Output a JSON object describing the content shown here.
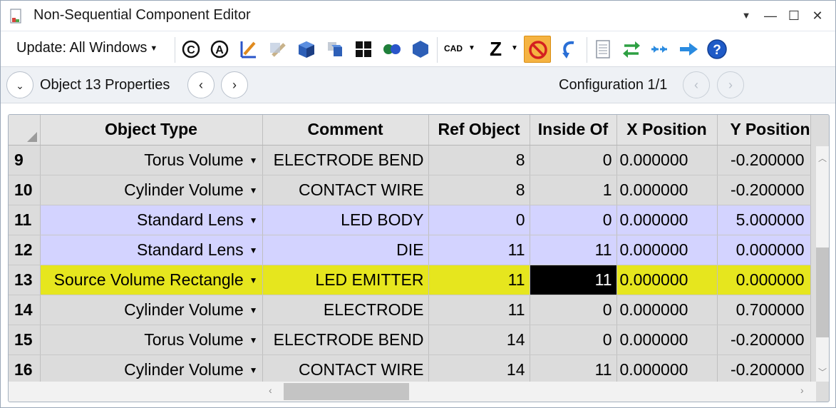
{
  "window": {
    "title": "Non-Sequential Component Editor"
  },
  "title_buttons": {
    "dropdown": "▼",
    "minimize": "—",
    "maximize": "☐",
    "close": "✕"
  },
  "toolbar": {
    "update_label": "Update: All Windows",
    "icons": [
      "reload-c-icon",
      "reload-a-icon",
      "pencil-ruler-icon",
      "pencil-disabled-icon",
      "cube-icon",
      "cube-stack-icon",
      "grid-squares-icon",
      "dots-icon",
      "hexagon-icon",
      "cad-icon",
      "z-icon",
      "no-entry-icon",
      "undo-arrow-icon",
      "report-icon",
      "swap-arrows-icon",
      "dash-arrows-icon",
      "right-arrow-icon",
      "help-icon"
    ],
    "cad_label": "CAD",
    "z_label": "Z",
    "accent_active": "#f5b342"
  },
  "objectbar": {
    "object_label": "Object  13 Properties",
    "config_label": "Configuration 1/1"
  },
  "grid": {
    "headers": [
      "Object Type",
      "Comment",
      "Ref Object",
      "Inside Of",
      "X Position",
      "Y Position"
    ],
    "rows": [
      {
        "num": "9",
        "type": "Torus Volume",
        "comment": "ELECTRODE BEND",
        "ref": "8",
        "inside": "0",
        "x": "0.000000",
        "y": "-0.200000",
        "style": "gray"
      },
      {
        "num": "10",
        "type": "Cylinder Volume",
        "comment": "CONTACT WIRE",
        "ref": "8",
        "inside": "1",
        "x": "0.000000",
        "y": "-0.200000",
        "style": "gray"
      },
      {
        "num": "11",
        "type": "Standard Lens",
        "comment": "LED BODY",
        "ref": "0",
        "inside": "0",
        "x": "0.000000",
        "y": "5.000000",
        "style": "lav"
      },
      {
        "num": "12",
        "type": "Standard Lens",
        "comment": "DIE",
        "ref": "11",
        "inside": "11",
        "x": "0.000000",
        "y": "0.000000",
        "style": "lav"
      },
      {
        "num": "13",
        "type": "Source Volume Rectangle",
        "comment": "LED EMITTER",
        "ref": "11",
        "inside": "11",
        "x": "0.000000",
        "y": "0.000000",
        "style": "yel"
      },
      {
        "num": "14",
        "type": "Cylinder Volume",
        "comment": "ELECTRODE",
        "ref": "11",
        "inside": "0",
        "x": "0.000000",
        "y": "0.700000",
        "style": "gray"
      },
      {
        "num": "15",
        "type": "Torus Volume",
        "comment": "ELECTRODE BEND",
        "ref": "14",
        "inside": "0",
        "x": "0.000000",
        "y": "-0.200000",
        "style": "gray"
      },
      {
        "num": "16",
        "type": "Cylinder Volume",
        "comment": "CONTACT WIRE",
        "ref": "14",
        "inside": "11",
        "x": "0.000000",
        "y": "-0.200000",
        "style": "gray"
      }
    ],
    "selected_cell": {
      "row_num": "13",
      "column": "Inside Of"
    },
    "colors": {
      "gray": "#dcdcdc",
      "lavender": "#d3d3ff",
      "yellow": "#e6e61e",
      "selected": "#000000"
    }
  }
}
